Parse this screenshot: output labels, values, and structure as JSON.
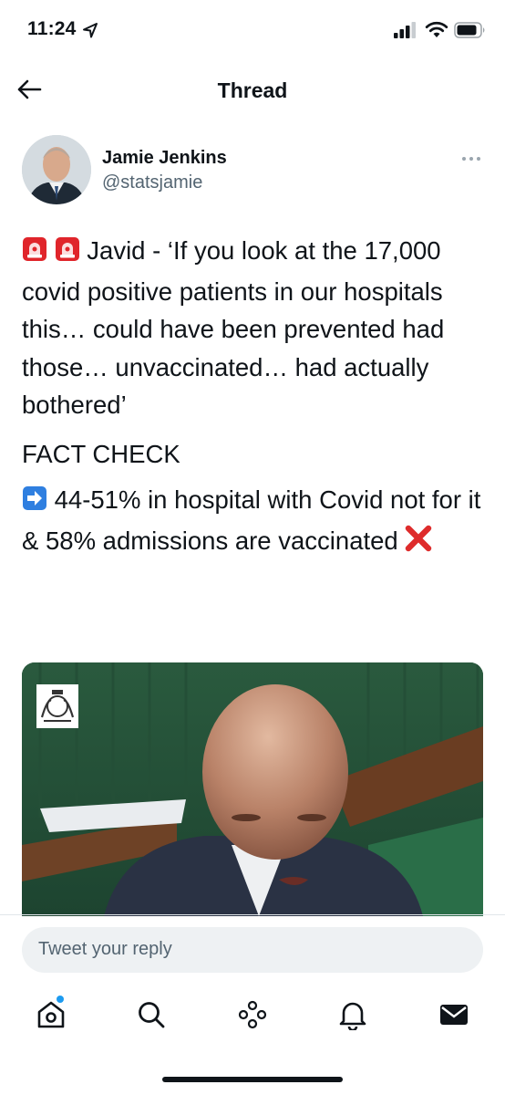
{
  "status_bar": {
    "time": "11:24",
    "icons": [
      "location-arrow-icon",
      "cellular-signal-icon",
      "wifi-icon",
      "battery-icon"
    ]
  },
  "header": {
    "back_icon": "arrow-left-icon",
    "title": "Thread"
  },
  "tweet": {
    "author": {
      "name": "Jamie Jenkins",
      "handle": "@statsjamie",
      "avatar_icon": "avatar-photo"
    },
    "more_icon": "more-dots-icon",
    "paragraphs": {
      "quote": "Javid - ‘If you look at the 17,000 covid positive patients in our hospitals this… could have been prevented had those… unvaccinated… had actually bothered’",
      "fact_check": "FACT CHECK",
      "claim": "44-51% in hospital with Covid not for it & 58% admissions are vaccinated"
    },
    "emoji": {
      "siren": "🚨",
      "right_arrow": "➡️",
      "cross": "❌"
    },
    "media": {
      "type": "image",
      "crest_icon": "royal-coat-of-arms-icon"
    }
  },
  "reply": {
    "placeholder": "Tweet your reply"
  },
  "tab_bar": {
    "items": [
      {
        "name": "home",
        "icon": "home-icon",
        "has_notification_dot": true
      },
      {
        "name": "search",
        "icon": "search-icon"
      },
      {
        "name": "spaces",
        "icon": "spaces-icon"
      },
      {
        "name": "notifications",
        "icon": "bell-icon"
      },
      {
        "name": "messages",
        "icon": "mail-icon"
      }
    ]
  },
  "colors": {
    "accent": "#1d9bf0",
    "text_primary": "#0f1419",
    "text_secondary": "#536471",
    "siren_red": "#e0252b",
    "arrow_blue": "#2f7fe0",
    "cross_red": "#de2c2c"
  }
}
